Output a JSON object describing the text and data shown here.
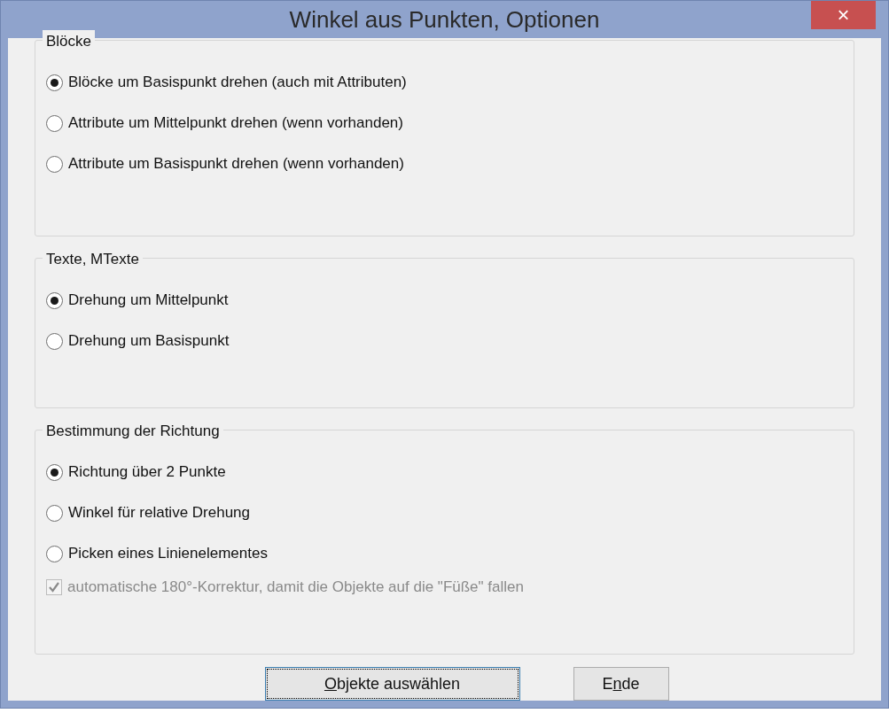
{
  "window": {
    "title": "Winkel aus Punkten, Optionen",
    "close": "×"
  },
  "groups": [
    {
      "title": "Blöcke",
      "options": [
        {
          "kind": "radio",
          "label": "Blöcke um Basispunkt drehen (auch mit Attributen)",
          "selected": true
        },
        {
          "kind": "radio",
          "label": "Attribute um Mittelpunkt drehen (wenn vorhanden)",
          "selected": false
        },
        {
          "kind": "radio",
          "label": "Attribute um Basispunkt drehen (wenn vorhanden)",
          "selected": false
        }
      ]
    },
    {
      "title": "Texte, MTexte",
      "options": [
        {
          "kind": "radio",
          "label": "Drehung um Mittelpunkt",
          "selected": true
        },
        {
          "kind": "radio",
          "label": "Drehung um Basispunkt",
          "selected": false
        }
      ]
    },
    {
      "title": "Bestimmung der Richtung",
      "options": [
        {
          "kind": "radio",
          "label": "Richtung über 2 Punkte",
          "selected": true
        },
        {
          "kind": "radio",
          "label": "Winkel für relative Drehung",
          "selected": false
        },
        {
          "kind": "radio",
          "label": "Picken eines Linienelementes",
          "selected": false
        },
        {
          "kind": "checkbox",
          "label": "automatische 180°-Korrektur, damit die Objekte auf die \"Füße\" fallen",
          "checked": true,
          "disabled": true
        }
      ]
    }
  ],
  "buttons": [
    {
      "accel": "O",
      "after": "bjekte auswählen",
      "focused": true
    },
    {
      "before": "E",
      "accel": "n",
      "after": "de",
      "focused": false
    }
  ]
}
